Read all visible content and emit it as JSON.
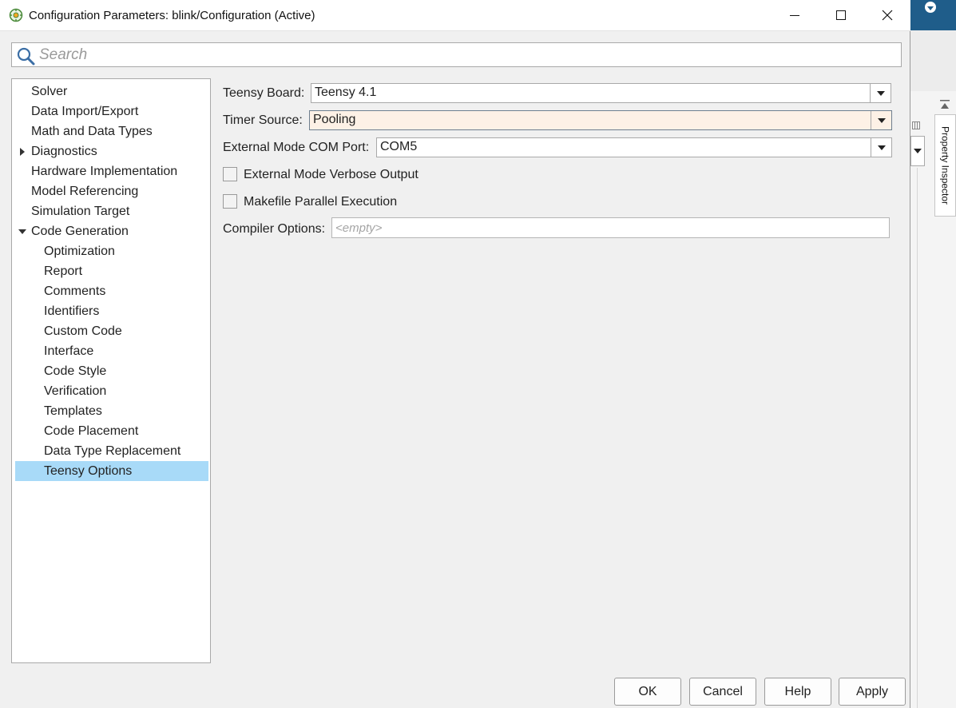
{
  "window": {
    "title": "Configuration Parameters: blink/Configuration (Active)",
    "icon": "config-gear-icon"
  },
  "search": {
    "placeholder": "Search",
    "value": ""
  },
  "tree": {
    "items": [
      {
        "label": "Solver",
        "level": 1
      },
      {
        "label": "Data Import/Export",
        "level": 1
      },
      {
        "label": "Math and Data Types",
        "level": 1
      },
      {
        "label": "Diagnostics",
        "level": 1,
        "expander": "collapsed"
      },
      {
        "label": "Hardware Implementation",
        "level": 1
      },
      {
        "label": "Model Referencing",
        "level": 1
      },
      {
        "label": "Simulation Target",
        "level": 1
      },
      {
        "label": "Code Generation",
        "level": 1,
        "expander": "expanded"
      },
      {
        "label": "Optimization",
        "level": 2
      },
      {
        "label": "Report",
        "level": 2
      },
      {
        "label": "Comments",
        "level": 2
      },
      {
        "label": "Identifiers",
        "level": 2
      },
      {
        "label": "Custom Code",
        "level": 2
      },
      {
        "label": "Interface",
        "level": 2
      },
      {
        "label": "Code Style",
        "level": 2
      },
      {
        "label": "Verification",
        "level": 2
      },
      {
        "label": "Templates",
        "level": 2
      },
      {
        "label": "Code Placement",
        "level": 2
      },
      {
        "label": "Data Type Replacement",
        "level": 2
      },
      {
        "label": "Teensy Options",
        "level": 2,
        "selected": true
      }
    ]
  },
  "form": {
    "teensy_board": {
      "label": "Teensy Board:",
      "value": "Teensy 4.1"
    },
    "timer_source": {
      "label": "Timer Source:",
      "value": "Pooling"
    },
    "com_port": {
      "label": "External Mode COM Port:",
      "value": "COM5"
    },
    "verbose_output": {
      "label": "External Mode Verbose Output",
      "checked": false
    },
    "parallel_exec": {
      "label": "Makefile Parallel Execution",
      "checked": false
    },
    "compiler_options": {
      "label": "Compiler Options:",
      "placeholder": "<empty>",
      "value": ""
    }
  },
  "buttons": {
    "ok": "OK",
    "cancel": "Cancel",
    "help": "Help",
    "apply": "Apply"
  },
  "background_app": {
    "property_inspector_label": "Property Inspector"
  },
  "colors": {
    "selection": "#a8daf8",
    "active_field": "#fdf1e6",
    "app_accent": "#1f5d8a"
  }
}
